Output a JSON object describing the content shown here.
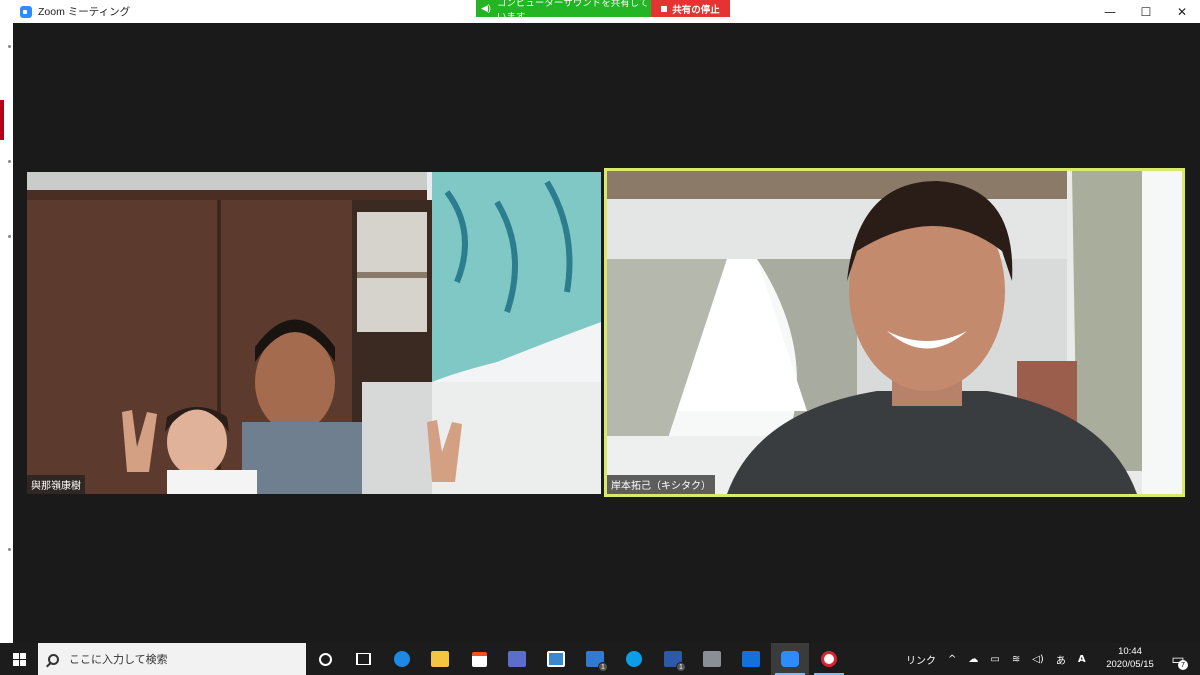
{
  "window": {
    "title": "Zoom ミーティング",
    "minimize": "—",
    "maximize": "☐",
    "close": "✕"
  },
  "share_bar": {
    "status": "コンピューターサウンドを共有しています",
    "stop_label": "共有の停止",
    "status_color": "#23b523",
    "stop_color": "#e53333"
  },
  "participants": [
    {
      "name": "與那嶺康樹",
      "active_speaker": false
    },
    {
      "name": "岸本拓己（キシタク）",
      "active_speaker": true,
      "highlight_color": "#d9ea6a"
    }
  ],
  "taskbar": {
    "search_placeholder": "ここに入力して検索",
    "apps": [
      {
        "name": "cortana",
        "badge": ""
      },
      {
        "name": "task-view",
        "badge": ""
      },
      {
        "name": "edge",
        "badge": ""
      },
      {
        "name": "file-explorer",
        "badge": ""
      },
      {
        "name": "store",
        "badge": ""
      },
      {
        "name": "calculator",
        "badge": ""
      },
      {
        "name": "news",
        "badge": ""
      },
      {
        "name": "mail",
        "badge": "1"
      },
      {
        "name": "skype",
        "badge": ""
      },
      {
        "name": "facebook",
        "badge": "1"
      },
      {
        "name": "app-gray",
        "badge": ""
      },
      {
        "name": "pandora",
        "badge": ""
      },
      {
        "name": "zoom",
        "badge": ""
      },
      {
        "name": "media",
        "badge": ""
      }
    ],
    "tray": {
      "links": "リンク",
      "ime": "あ",
      "time": "10:44",
      "date": "2020/05/15",
      "notifications": "7"
    }
  }
}
